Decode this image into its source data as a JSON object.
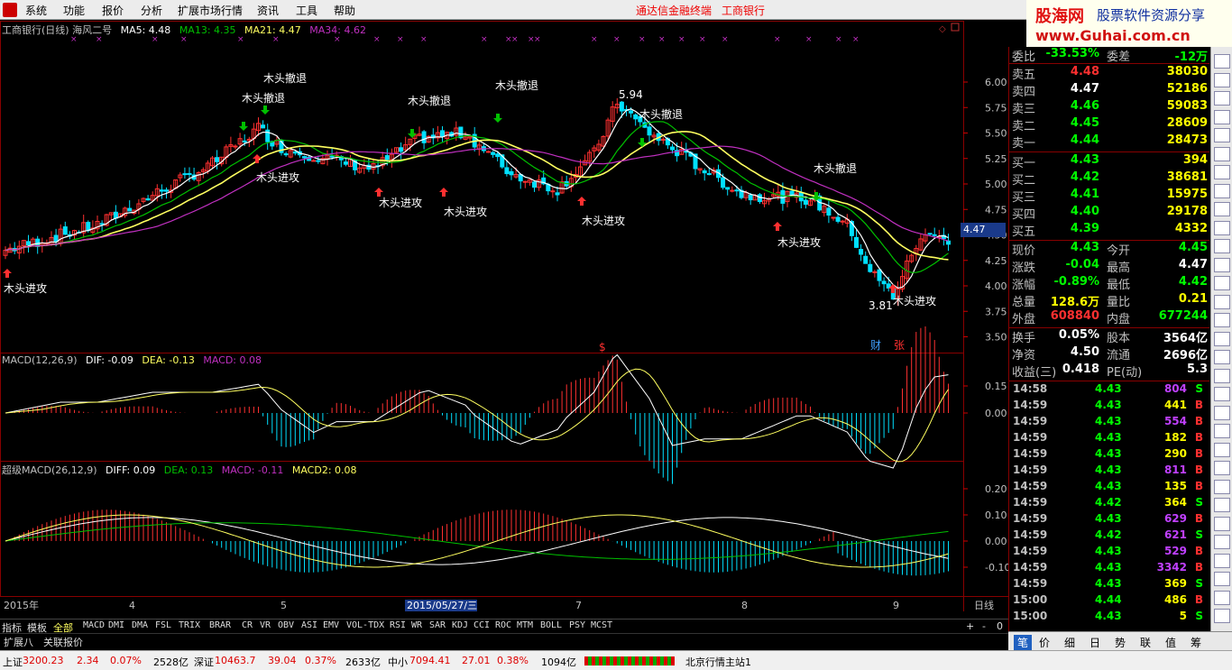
{
  "menu": {
    "items": [
      "系统",
      "功能",
      "报价",
      "分析",
      "扩展市场行情",
      "资讯",
      "工具",
      "帮助"
    ],
    "center_title": "通达信金融终端",
    "center_stock": "工商银行"
  },
  "brand": {
    "name": "股海网",
    "slogan": "股票软件资源分享",
    "url": "www.Guhai.com.cn"
  },
  "main": {
    "title": "工商银行(日线) 海风二号",
    "ma5": "MA5: 4.48",
    "ma13": "MA13: 4.35",
    "ma21": "MA21: 4.47",
    "ma34": "MA34: 4.62",
    "price_ticks": [
      "6.00",
      "5.75",
      "5.50",
      "5.25",
      "5.00",
      "4.75",
      "4.50",
      "4.25",
      "4.00",
      "3.75",
      "3.50"
    ],
    "current_price": "4.47",
    "high_label": "5.94",
    "low_label": "3.81",
    "sig_retreat": "木头撤退",
    "sig_attack": "木头进攻",
    "cai": "财",
    "zhang": "张",
    "dollar": "$"
  },
  "macd": {
    "title": "MACD(12,26,9)",
    "dif": "DIF: -0.09",
    "dea": "DEA: -0.13",
    "macd": "MACD: 0.08",
    "ticks": [
      "0.15",
      "0.00"
    ]
  },
  "smacd": {
    "title": "超级MACD(26,12,9)",
    "diff": "DIFF: 0.09",
    "dea": "DEA: 0.13",
    "macd": "MACD: -0.11",
    "macd2": "MACD2: 0.08",
    "ticks": [
      "0.20",
      "0.10",
      "0.00",
      "-0.10"
    ]
  },
  "xaxis": {
    "year": "2015年",
    "m4": "4",
    "m5": "5",
    "cursor": "2015/05/27/三",
    "m7": "7",
    "m8": "8",
    "m9": "9",
    "period": "日线"
  },
  "tabs": [
    "指标",
    "模板",
    "全部",
    "MACD",
    "DMI",
    "DMA",
    "FSL",
    "TRIX",
    "BRAR",
    "CR",
    "VR",
    "OBV",
    "ASI",
    "EMV",
    "VOL-TDX",
    "RSI",
    "WR",
    "SAR",
    "KDJ",
    "CCI",
    "ROC",
    "MTM",
    "BOLL",
    "PSY",
    "MCST"
  ],
  "ext": {
    "a": "扩展八",
    "b": "关联报价",
    "plus": "+",
    "minus": "-",
    "zero": "0"
  },
  "quote": {
    "weibi": {
      "label": "委比",
      "v1": "-33.53%",
      "label2": "委差",
      "v2": "-12万"
    },
    "sells": [
      {
        "label": "卖五",
        "price": "4.48",
        "vol": "38030",
        "color": "#ff3030"
      },
      {
        "label": "卖四",
        "price": "4.47",
        "vol": "52186",
        "color": "#ffffff"
      },
      {
        "label": "卖三",
        "price": "4.46",
        "vol": "59083",
        "color": "#00ff00"
      },
      {
        "label": "卖二",
        "price": "4.45",
        "vol": "28609",
        "color": "#00ff00"
      },
      {
        "label": "卖一",
        "price": "4.44",
        "vol": "28473",
        "color": "#00ff00"
      }
    ],
    "buys": [
      {
        "label": "买一",
        "price": "4.43",
        "vol": "394",
        "color": "#00ff00"
      },
      {
        "label": "买二",
        "price": "4.42",
        "vol": "38681",
        "color": "#00ff00"
      },
      {
        "label": "买三",
        "price": "4.41",
        "vol": "15975",
        "color": "#00ff00"
      },
      {
        "label": "买四",
        "price": "4.40",
        "vol": "29178",
        "color": "#00ff00"
      },
      {
        "label": "买五",
        "price": "4.39",
        "vol": "4332",
        "color": "#00ff00"
      }
    ],
    "stats": [
      {
        "l1": "现价",
        "v1": "4.43",
        "c1": "#00ff00",
        "l2": "今开",
        "v2": "4.45",
        "c2": "#00ff00"
      },
      {
        "l1": "涨跌",
        "v1": "-0.04",
        "c1": "#00ff00",
        "l2": "最高",
        "v2": "4.47",
        "c2": "#ffffff"
      },
      {
        "l1": "涨幅",
        "v1": "-0.89%",
        "c1": "#00ff00",
        "l2": "最低",
        "v2": "4.42",
        "c2": "#00ff00"
      },
      {
        "l1": "总量",
        "v1": "128.6万",
        "c1": "#ffff00",
        "l2": "量比",
        "v2": "0.21",
        "c2": "#ffff00"
      },
      {
        "l1": "外盘",
        "v1": "608840",
        "c1": "#ff3030",
        "l2": "内盘",
        "v2": "677244",
        "c2": "#00ff00"
      }
    ],
    "fin": [
      {
        "l1": "换手",
        "v1": "0.05%",
        "l2": "股本",
        "v2": "3564亿"
      },
      {
        "l1": "净资",
        "v1": "4.50",
        "l2": "流通",
        "v2": "2696亿"
      },
      {
        "l1": "收益(三)",
        "v1": "0.418",
        "l2": "PE(动)",
        "v2": "5.3"
      }
    ],
    "ticks": [
      {
        "t": "14:58",
        "p": "4.43",
        "v": "804",
        "s": "S",
        "vc": "#c040ff"
      },
      {
        "t": "14:59",
        "p": "4.43",
        "v": "441",
        "s": "B",
        "vc": "#ffff00"
      },
      {
        "t": "14:59",
        "p": "4.43",
        "v": "554",
        "s": "B",
        "vc": "#c040ff"
      },
      {
        "t": "14:59",
        "p": "4.43",
        "v": "182",
        "s": "B",
        "vc": "#ffff00"
      },
      {
        "t": "14:59",
        "p": "4.43",
        "v": "290",
        "s": "B",
        "vc": "#ffff00"
      },
      {
        "t": "14:59",
        "p": "4.43",
        "v": "811",
        "s": "B",
        "vc": "#c040ff"
      },
      {
        "t": "14:59",
        "p": "4.43",
        "v": "135",
        "s": "B",
        "vc": "#ffff00"
      },
      {
        "t": "14:59",
        "p": "4.42",
        "v": "364",
        "s": "S",
        "vc": "#ffff00"
      },
      {
        "t": "14:59",
        "p": "4.43",
        "v": "629",
        "s": "B",
        "vc": "#c040ff"
      },
      {
        "t": "14:59",
        "p": "4.42",
        "v": "621",
        "s": "S",
        "vc": "#c040ff"
      },
      {
        "t": "14:59",
        "p": "4.43",
        "v": "529",
        "s": "B",
        "vc": "#c040ff"
      },
      {
        "t": "14:59",
        "p": "4.43",
        "v": "3342",
        "s": "B",
        "vc": "#c040ff"
      },
      {
        "t": "14:59",
        "p": "4.43",
        "v": "369",
        "s": "S",
        "vc": "#ffff00"
      },
      {
        "t": "15:00",
        "p": "4.44",
        "v": "486",
        "s": "B",
        "vc": "#ffff00"
      },
      {
        "t": "15:00",
        "p": "4.43",
        "v": "5",
        "s": "S",
        "vc": "#ffff00"
      }
    ]
  },
  "sidetabs": [
    "笔",
    "价",
    "细",
    "日",
    "势",
    "联",
    "值",
    "筹"
  ],
  "status": {
    "sh_label": "上证",
    "sh_val": "3200.23",
    "sh_chg": "2.34",
    "sh_pct": "0.07%",
    "sh_amt": "2528亿",
    "sz_label": "深证",
    "sz_val": "10463.7",
    "sz_chg": "39.04",
    "sz_pct": "0.37%",
    "sz_amt": "2633亿",
    "zx_label": "中小",
    "zx_val": "7094.41",
    "zx_chg": "27.01",
    "zx_pct": "0.38%",
    "zx_amt": "1094亿",
    "server": "北京行情主站1"
  },
  "colors": {
    "up": "#ff3030",
    "down": "#00e0ff",
    "ma5": "#ffffff",
    "ma13": "#00c000",
    "ma21": "#ffff60",
    "ma34": "#c030c0"
  }
}
